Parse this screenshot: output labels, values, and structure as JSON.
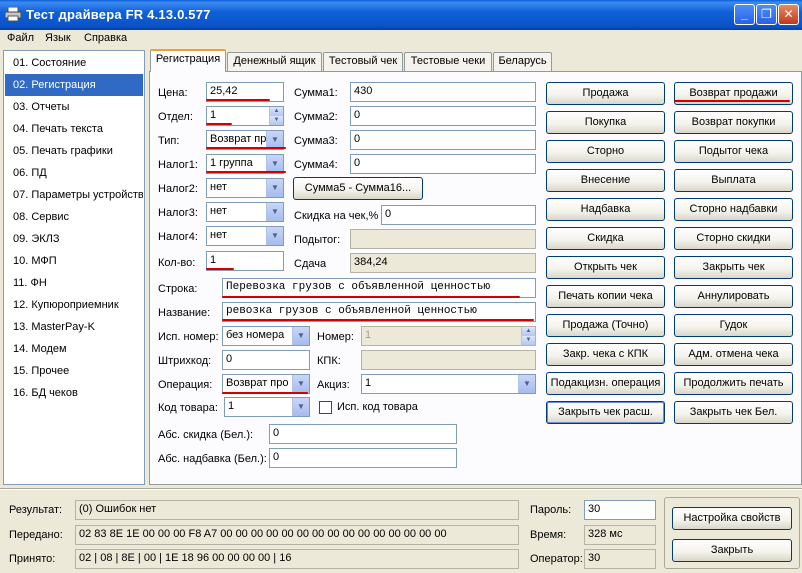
{
  "window": {
    "title": "Тест драйвера FR 4.13.0.577",
    "min": "_",
    "max": "❐",
    "close": "✕"
  },
  "menu": [
    "Файл",
    "Язык",
    "Справка"
  ],
  "nav": [
    "01. Состояние",
    "02. Регистрация",
    "03. Отчеты",
    "04. Печать текста",
    "05. Печать графики",
    "06. ПД",
    "07. Параметры устройства",
    "08. Сервис",
    "09. ЭКЛЗ",
    "10. МФП",
    "11. ФН",
    "12. Купюроприемник",
    "13. MasterPay-K",
    "14. Модем",
    "15. Прочее",
    "16. БД чеков"
  ],
  "nav_selected_index": 1,
  "tabs": [
    "Регистрация",
    "Денежный ящик",
    "Тестовый чек",
    "Тестовые чеки",
    "Беларусь"
  ],
  "form": {
    "price_label": "Цена:",
    "price": "25,42",
    "dept_label": "Отдел:",
    "dept": "1",
    "type_label": "Тип:",
    "type": "Возврат пр",
    "tax1_label": "Налог1:",
    "tax1": "1 группа",
    "tax2_label": "Налог2:",
    "tax2": "нет",
    "tax3_label": "Налог3:",
    "tax3": "нет",
    "tax4_label": "Налог4:",
    "tax4": "нет",
    "qty_label": "Кол-во:",
    "qty": "1",
    "sum1_label": "Сумма1:",
    "sum1": "430",
    "sum2_label": "Сумма2:",
    "sum2": "0",
    "sum3_label": "Сумма3:",
    "sum3": "0",
    "sum4_label": "Сумма4:",
    "sum4": "0",
    "sum5_button": "Сумма5 - Сумма16...",
    "discount_label": "Скидка на чек,%",
    "discount": "0",
    "subtotal_label": "Подытог:",
    "subtotal": "",
    "change_label": "Сдача",
    "change": "384,24",
    "string_label": "Строка:",
    "string": "Перевозка грузов с объявленной ценностью",
    "name_label": "Название:",
    "name": "ревозка грузов с объявленной ценностью",
    "use_number_label": "Исп. номер:",
    "use_number": "без номера",
    "number_label": "Номер:",
    "number": "1",
    "barcode_label": "Штрихкод:",
    "barcode": "0",
    "kpk_label": "КПК:",
    "kpk": "",
    "operation_label": "Операция:",
    "operation": "Возврат про",
    "excise_label": "Акциз:",
    "excise": "1",
    "product_code_label": "Код товара:",
    "product_code": "1",
    "use_product_code_label": "Исп. код товара",
    "abs_discount_label": "Абс. скидка (Бел.):",
    "abs_discount": "0",
    "abs_markup_label": "Абс. надбавка (Бел.):",
    "abs_markup": "0"
  },
  "buttons_col1": [
    "Продажа",
    "Покупка",
    "Сторно",
    "Внесение",
    "Надбавка",
    "Скидка",
    "Открыть чек",
    "Печать копии чека",
    "Продажа (Точно)",
    "Закр. чека с КПК",
    "Подакцизн. операция",
    "Закрыть чек расш."
  ],
  "buttons_col2": [
    "Возврат продажи",
    "Возврат покупки",
    "Подытог чека",
    "Выплата",
    "Сторно надбавки",
    "Сторно скидки",
    "Закрыть чек",
    "Аннулировать",
    "Гудок",
    "Адм. отмена чека",
    "Продолжить печать",
    "Закрыть чек Бел."
  ],
  "status": {
    "result_label": "Результат:",
    "result": "(0) Ошибок нет",
    "sent_label": "Передано:",
    "sent": "02 83 8E 1E 00 00 00 F8 A7 00 00 00 00 00 00 00 00 00 00 00 00 00 00 00",
    "received_label": "Принято:",
    "received": "02 | 08 | 8E | 00 | 1E 18 96 00 00 00 00 | 16",
    "password_label": "Пароль:",
    "password": "30",
    "time_label": "Время:",
    "time": "328 мс",
    "operator_label": "Оператор:",
    "operator": "30",
    "settings_button": "Настройка свойств",
    "close_button": "Закрыть"
  },
  "accent": {
    "title": "#0a5fd8",
    "selected": "#316ac5",
    "annotation": "#d40000"
  }
}
